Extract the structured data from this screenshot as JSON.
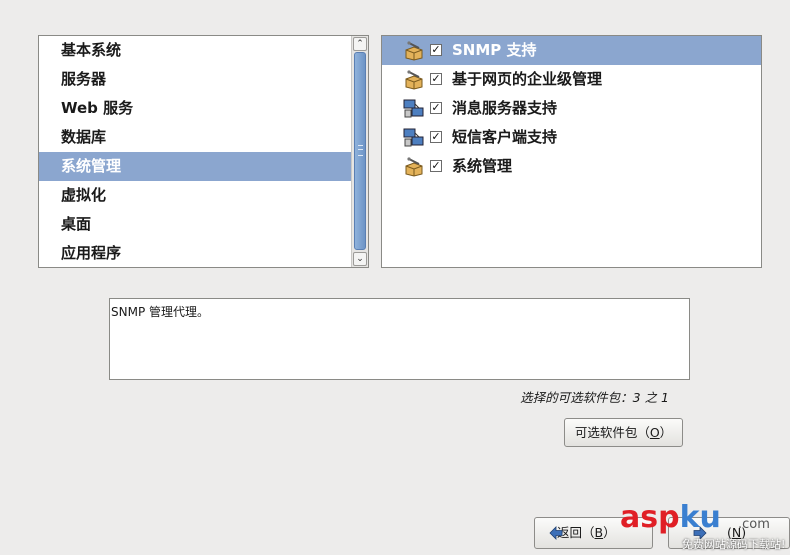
{
  "categories": {
    "items": [
      "基本系统",
      "服务器",
      "Web 服务",
      "数据库",
      "系统管理",
      "虚拟化",
      "桌面",
      "应用程序"
    ],
    "selected_index": 4,
    "scroll_up": "⌃",
    "scroll_down": "⌄"
  },
  "packages": {
    "items": [
      {
        "label": "SNMP 支持",
        "checked": true,
        "icon": "package-icon",
        "selected": true
      },
      {
        "label": "基于网页的企业级管理",
        "checked": true,
        "icon": "package-icon",
        "selected": false
      },
      {
        "label": "消息服务器支持",
        "checked": true,
        "icon": "network-computers-icon",
        "selected": false
      },
      {
        "label": "短信客户端支持",
        "checked": true,
        "icon": "network-computers-icon",
        "selected": false
      },
      {
        "label": "系统管理",
        "checked": true,
        "icon": "package-icon",
        "selected": false
      }
    ],
    "check_mark": "✓"
  },
  "description": "SNMP 管理代理。",
  "selected_count": "选择的可选软件包：3 之 1",
  "buttons": {
    "optional_packages": {
      "text": "可选软件包（",
      "key": "O",
      "end": "）"
    },
    "back": {
      "text": "返回（",
      "key": "B",
      "end": "）"
    },
    "next": {
      "text": "(",
      "key": "N",
      "end": ")"
    }
  },
  "watermark": {
    "asp": "asp",
    "ku": "ku",
    "domain": ".com",
    "subtitle": "免费网站源码下载站!"
  },
  "colors": {
    "selection": "#8ba6cf",
    "background": "#edeceb",
    "scroll_thumb": "#7fa3d2"
  }
}
